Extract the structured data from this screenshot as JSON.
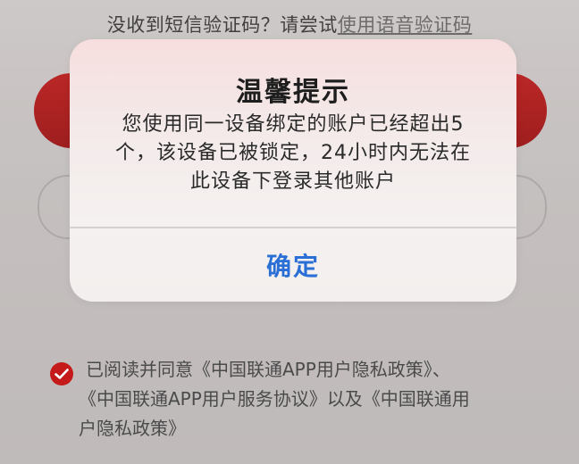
{
  "voice_hint": {
    "prefix": "没收到短信验证码？请尝试",
    "link": "使用语音验证码"
  },
  "alert": {
    "title": "温馨提示",
    "message_line1": "您使用同一设备绑定的账户已经超出5",
    "message_line2": "个，该设备已被锁定，24小时内无法在",
    "message_line3": "此设备下登录其他账户",
    "confirm_label": "确定"
  },
  "agreement": {
    "checked": true,
    "prefix": "已阅读并同意",
    "policy_link_1": "《中国联通APP用户隐私政策》",
    "separator": "、",
    "service_link": "《中国联通APP用户服务协议》",
    "conjunction": "以及",
    "policy_link_2_part1": "《中国联通用",
    "policy_link_2_part2": "户隐私政策》"
  },
  "colors": {
    "brand_red": "#c41a1a",
    "link_blue": "#2a6fd6"
  },
  "icons": {
    "agree_check": "check-icon"
  }
}
